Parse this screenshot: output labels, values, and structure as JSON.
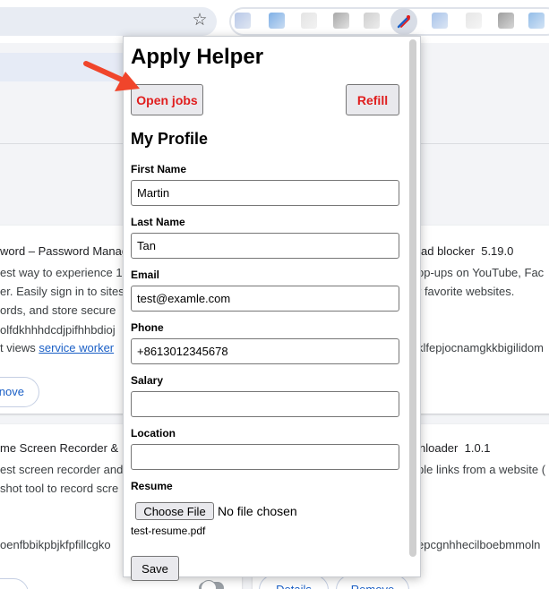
{
  "popup": {
    "title": "Apply Helper",
    "open_jobs_label": "Open jobs",
    "refill_label": "Refill",
    "section_title": "My Profile",
    "fields": [
      {
        "label": "First Name",
        "value": "Martin"
      },
      {
        "label": "Last Name",
        "value": "Tan"
      },
      {
        "label": "Email",
        "value": "test@examle.com"
      },
      {
        "label": "Phone",
        "value": "+8613012345678"
      },
      {
        "label": "Salary",
        "value": ""
      },
      {
        "label": "Location",
        "value": ""
      }
    ],
    "resume": {
      "label": "Resume",
      "choose_file_label": "Choose File",
      "status": "No file chosen",
      "current_file": "test-resume.pdf"
    },
    "save_label": "Save"
  },
  "background": {
    "card1": {
      "title": "word – Password Manag",
      "line1": "est way to experience 1",
      "line2": "er. Easily sign in to sites",
      "line3": "ords, and store secure",
      "id": "olfdkhhhdcdjpifhhbdioj",
      "views_prefix": "t views ",
      "views_link": "service worker",
      "remove_label": "nove"
    },
    "card2": {
      "title": "ad blocker",
      "version": "5.19.0",
      "line1": "op-ups on YouTube, Fac",
      "line2": "r favorite websites.",
      "id": "klfepjocnamgkkbigilidom"
    },
    "card3": {
      "title": "me Screen Recorder &",
      "line1": "est screen recorder and",
      "line2": "shot tool to record scre",
      "id": "oenfbbikpbjkfpfillcgko"
    },
    "card4": {
      "title": "nloader",
      "version": "1.0.1",
      "line1": "ble links from a website (",
      "id": "epcgnhhecilboebmmoln",
      "details_label": "Details",
      "remove_label": "Remove"
    }
  },
  "colors": {
    "popup_button_text": "#e01e1e",
    "annotation_arrow": "#f0452b",
    "link": "#1a5fc6"
  },
  "icons": {
    "bookmark": "star-icon",
    "active_extension": "apply-helper-extension-icon"
  }
}
